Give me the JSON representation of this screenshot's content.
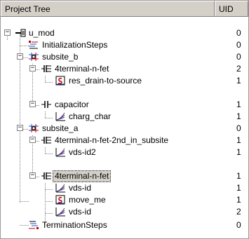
{
  "header": {
    "tree_label": "Project Tree",
    "uid_label": "UID"
  },
  "rows": [
    {
      "label": "u_mod",
      "uid": "0",
      "icon": "module-icon",
      "expander": "−"
    },
    {
      "label": "InitializationSteps",
      "uid": "0",
      "icon": "init-steps-icon",
      "expander": ""
    },
    {
      "label": "subsite_b",
      "uid": "0",
      "icon": "subsite-icon",
      "expander": "−"
    },
    {
      "label": "4terminal-n-fet",
      "uid": "2",
      "icon": "fet-icon",
      "expander": "−"
    },
    {
      "label": "res_drain-to-source",
      "uid": "1",
      "icon": "script-icon",
      "expander": ""
    },
    {
      "label": "capacitor",
      "uid": "1",
      "icon": "capacitor-icon",
      "expander": "−"
    },
    {
      "label": "charg_char",
      "uid": "1",
      "icon": "measurement-icon",
      "expander": ""
    },
    {
      "label": "subsite_a",
      "uid": "0",
      "icon": "subsite-icon",
      "expander": "−"
    },
    {
      "label": "4terminal-n-fet-2nd_in_subsite",
      "uid": "1",
      "icon": "fet-icon",
      "expander": "−"
    },
    {
      "label": "vds-id2",
      "uid": "1",
      "icon": "measurement-icon",
      "expander": ""
    },
    {
      "label": "4terminal-n-fet",
      "uid": "1",
      "icon": "fet-icon",
      "expander": "−"
    },
    {
      "label": "vds-id",
      "uid": "1",
      "icon": "measurement-icon",
      "expander": ""
    },
    {
      "label": "move_me",
      "uid": "1",
      "icon": "script-icon",
      "expander": ""
    },
    {
      "label": "vds-id",
      "uid": "2",
      "icon": "measurement-icon",
      "expander": ""
    },
    {
      "label": "TerminationSteps",
      "uid": "0",
      "icon": "termination-steps-icon",
      "expander": ""
    }
  ]
}
